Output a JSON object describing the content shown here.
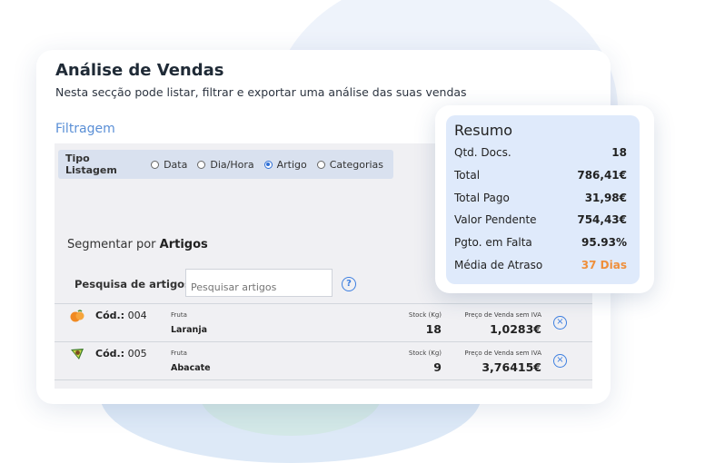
{
  "header": {
    "title": "Análise de Vendas",
    "subtitle": "Nesta secção pode listar, filtrar e exportar uma análise das suas vendas"
  },
  "filtragem": {
    "label": "Filtragem",
    "tipo_listagem_label": "Tipo Listagem",
    "options": [
      {
        "label": "Data",
        "selected": false
      },
      {
        "label": "Dia/Hora",
        "selected": false
      },
      {
        "label": "Artigo",
        "selected": true
      },
      {
        "label": "Categorias",
        "selected": false
      }
    ]
  },
  "segment": {
    "prefix": "Segmentar por",
    "value": "Artigos"
  },
  "search": {
    "label": "Pesquisa de artigos",
    "placeholder": "Pesquisar artigos",
    "help_icon": "question-circle-icon"
  },
  "articles": [
    {
      "icon": "orange-fruit-icon",
      "cod_label": "Cód.:",
      "cod": "004",
      "category": "Fruta",
      "name": "Laranja",
      "stock_label": "Stock (Kg)",
      "stock": "18",
      "price_label": "Preço de Venda sem IVA",
      "price": "1,0283€"
    },
    {
      "icon": "avocado-icon",
      "cod_label": "Cód.:",
      "cod": "005",
      "category": "Fruta",
      "name": "Abacate",
      "stock_label": "Stock (Kg)",
      "stock": "9",
      "price_label": "Preço de Venda sem IVA",
      "price": "3,76415€"
    }
  ],
  "resumo": {
    "title": "Resumo",
    "rows": [
      {
        "label": "Qtd. Docs.",
        "value": "18"
      },
      {
        "label": "Total",
        "value": "786,41€"
      },
      {
        "label": "Total Pago",
        "value": "31,98€"
      },
      {
        "label": "Valor Pendente",
        "value": "754,43€"
      },
      {
        "label": "Pgto. em Falta",
        "value": "95.93%"
      },
      {
        "label": "Média de Atraso",
        "value": "37 Dias",
        "color": "#ef8f3a"
      }
    ]
  },
  "colors": {
    "accent": "#3d7fe0",
    "filtragem": "#5a8fd6",
    "highlight": "#ef8f3a",
    "resumo_bg": "#dfeafb"
  }
}
